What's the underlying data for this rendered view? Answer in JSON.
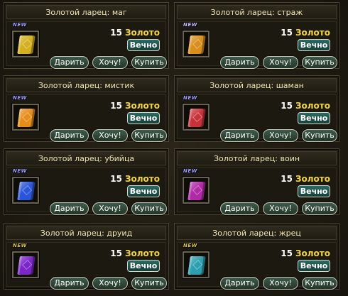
{
  "shop": {
    "items": [
      {
        "title": "Золотой ларец: маг",
        "price": "15",
        "currency": "Золото",
        "duration": "Вечно",
        "badge": "NEW",
        "badge_color": "#9d9dff",
        "book_color": "#d4b021",
        "buttons": {
          "gift": "Дарить",
          "want": "Хочу!",
          "buy": "Купить"
        }
      },
      {
        "title": "Золотой ларец: страж",
        "price": "15",
        "currency": "Золото",
        "duration": "Вечно",
        "badge": "NEW",
        "badge_color": "#c2b8ff",
        "book_color": "#d98e1c",
        "buttons": {
          "gift": "Дарить",
          "want": "Хочу!",
          "buy": "Купить"
        }
      },
      {
        "title": "Золотой ларец: мистик",
        "price": "15",
        "currency": "Золото",
        "duration": "Вечно",
        "badge": "NEW",
        "badge_color": "#9d9dff",
        "book_color": "#e68c1a",
        "buttons": {
          "gift": "Дарить",
          "want": "Хочу!",
          "buy": "Купить"
        }
      },
      {
        "title": "Золотой ларец: шаман",
        "price": "15",
        "currency": "Золото",
        "duration": "Вечно",
        "badge": "NEW",
        "badge_color": "#9d9dff",
        "book_color": "#c7323a",
        "buttons": {
          "gift": "Дарить",
          "want": "Хочу!",
          "buy": "Купить"
        }
      },
      {
        "title": "Золотой ларец: убийца",
        "price": "15",
        "currency": "Золото",
        "duration": "Вечно",
        "badge": "NEW",
        "badge_color": "#9d9dff",
        "book_color": "#2a55d8",
        "buttons": {
          "gift": "Дарить",
          "want": "Хочу!",
          "buy": "Купить"
        }
      },
      {
        "title": "Золотой ларец: воин",
        "price": "15",
        "currency": "Золото",
        "duration": "Вечно",
        "badge": "NEW",
        "badge_color": "#9d9dff",
        "book_color": "#b02aa8",
        "buttons": {
          "gift": "Дарить",
          "want": "Хочу!",
          "buy": "Купить"
        }
      },
      {
        "title": "Золотой ларец: друид",
        "price": "15",
        "currency": "Золото",
        "duration": "Вечно",
        "badge": "NEW",
        "badge_color": "#e2c34c",
        "book_color": "#7a26c8",
        "buttons": {
          "gift": "Дарить",
          "want": "Хочу!",
          "buy": "Купить"
        }
      },
      {
        "title": "Золотой ларец: жрец",
        "price": "15",
        "currency": "Золото",
        "duration": "Вечно",
        "badge": "NEW",
        "badge_color": "#e2c34c",
        "book_color": "#2e9fb0",
        "buttons": {
          "gift": "Дарить",
          "want": "Хочу!",
          "buy": "Купить"
        }
      }
    ]
  }
}
